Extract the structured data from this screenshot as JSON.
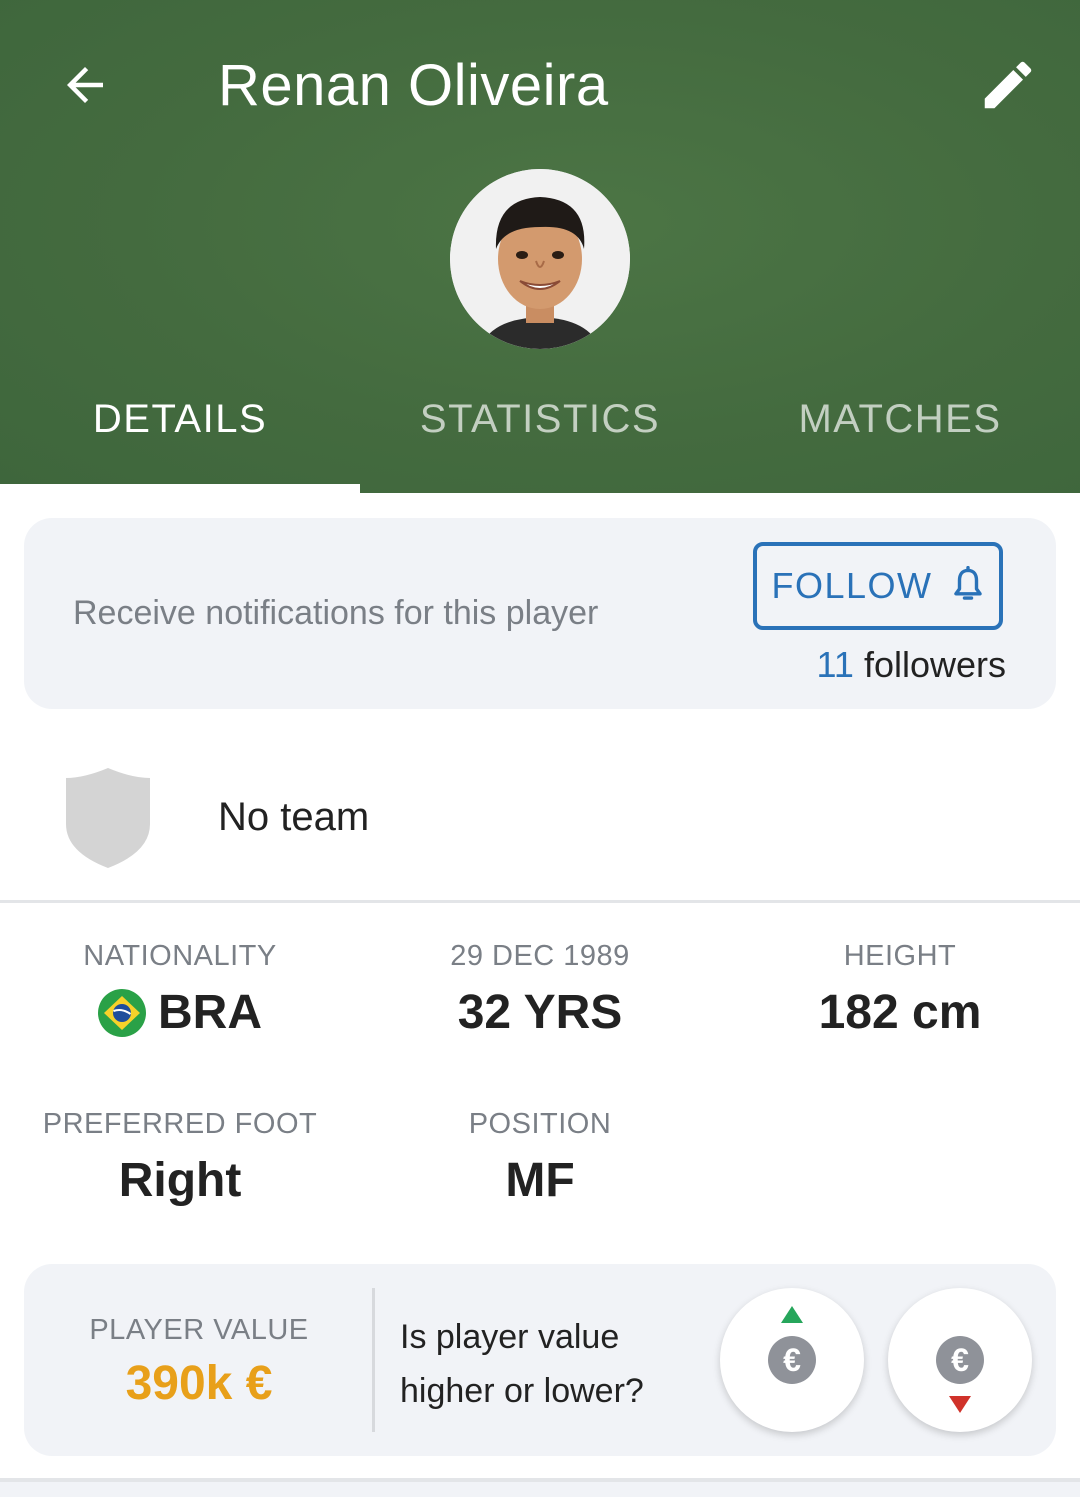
{
  "header": {
    "title": "Renan Oliveira",
    "back_icon": "arrow-back-icon",
    "edit_icon": "pencil-icon",
    "background_color": "#446b3f"
  },
  "tabs": [
    {
      "label": "DETAILS",
      "active": true
    },
    {
      "label": "STATISTICS",
      "active": false
    },
    {
      "label": "MATCHES",
      "active": false
    }
  ],
  "notifications": {
    "text": "Receive notifications for this player",
    "follow_label": "FOLLOW",
    "follow_icon": "bell-icon",
    "followers_count": "11",
    "followers_label": "followers",
    "accent_color": "#2a72b8"
  },
  "team": {
    "name": "No team",
    "icon": "shield-icon"
  },
  "stats": {
    "nationality": {
      "label": "NATIONALITY",
      "value": "BRA",
      "flag": "brazil-flag-icon"
    },
    "birth": {
      "label": "29 DEC 1989",
      "value": "32 YRS"
    },
    "height": {
      "label": "HEIGHT",
      "value": "182 cm"
    },
    "foot": {
      "label": "PREFERRED FOOT",
      "value": "Right"
    },
    "position": {
      "label": "POSITION",
      "value": "MF"
    }
  },
  "player_value": {
    "label": "PLAYER VALUE",
    "value": "390k €",
    "value_color": "#e8a01a",
    "question_line1": "Is player value",
    "question_line2": "higher or lower?",
    "euro_symbol": "€",
    "up_color": "#26a65b",
    "down_color": "#d0322a"
  }
}
